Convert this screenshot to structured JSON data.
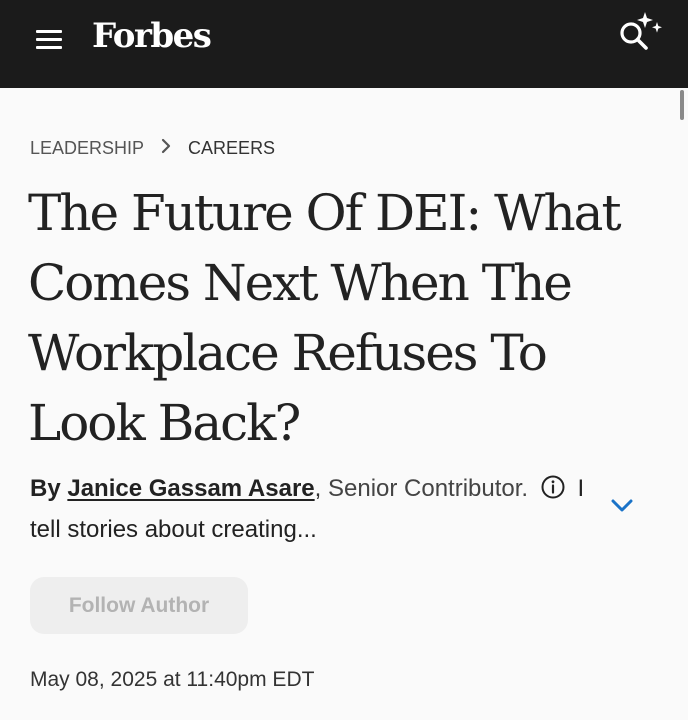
{
  "header": {
    "logo_text": "Forbes",
    "menu_icon": "hamburger-menu-icon",
    "search_icon": "search-sparkle-icon",
    "background_color": "#1b1b1b"
  },
  "breadcrumb": {
    "items": [
      "LEADERSHIP",
      "CAREERS"
    ],
    "separator_icon": "chevron-right-icon"
  },
  "article": {
    "headline": "The Future Of DEI: What Comes Next When The Workplace Refuses To Look Back?",
    "byline": {
      "prefix": "By",
      "author_name": "Janice Gassam Asare",
      "comma": ",",
      "role": "Senior Contributor.",
      "info_icon": "info-circle-icon",
      "bio_snippet": "I tell stories about creating...",
      "expand_icon": "chevron-down-icon",
      "expand_icon_color": "#1a73c8"
    },
    "follow_button_label": "Follow Author",
    "published": "May 08, 2025 at 11:40pm EDT"
  }
}
